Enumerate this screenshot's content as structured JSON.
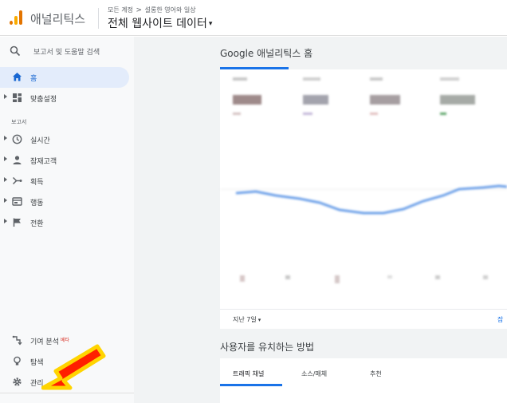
{
  "header": {
    "app_name": "애널리틱스",
    "breadcrumb_root": "모든 계정",
    "breadcrumb_separator": ">",
    "breadcrumb_property": "설롱한 영어와 일상",
    "view_title": "전체 웹사이트 데이터",
    "view_caret": "▾"
  },
  "sidebar": {
    "search_label": "보고서 및 도움말 검색",
    "home_label": "홈",
    "customization_label": "맞춤설정",
    "reports_section": "보고서",
    "reports": [
      {
        "label": "실시간",
        "icon": "clock-icon"
      },
      {
        "label": "잠재고객",
        "icon": "person-icon"
      },
      {
        "label": "획득",
        "icon": "acquisition-icon"
      },
      {
        "label": "행동",
        "icon": "behavior-icon"
      },
      {
        "label": "전환",
        "icon": "flag-icon"
      }
    ],
    "attribution_label": "기여 분석",
    "attribution_badge": "베타",
    "discover_label": "탐색",
    "admin_label": "관리"
  },
  "main": {
    "page_title": "Google 애널리틱스 홈",
    "date_range": "지난 7일",
    "date_range_caret": "▾",
    "more_link": "잠",
    "section2_title": "사용자를 유치하는 방법",
    "tabs": [
      "트래픽 채널",
      "소스/매체",
      "추천"
    ]
  },
  "colors": {
    "accent": "#1a73e8",
    "sidebar_bg": "#f8f9fa",
    "active_bg": "#e3ecfb",
    "logo_orange": "#f9ab00",
    "logo_dark": "#e37400",
    "arrow_red": "#ff1f00",
    "arrow_outline": "#ffd400"
  }
}
